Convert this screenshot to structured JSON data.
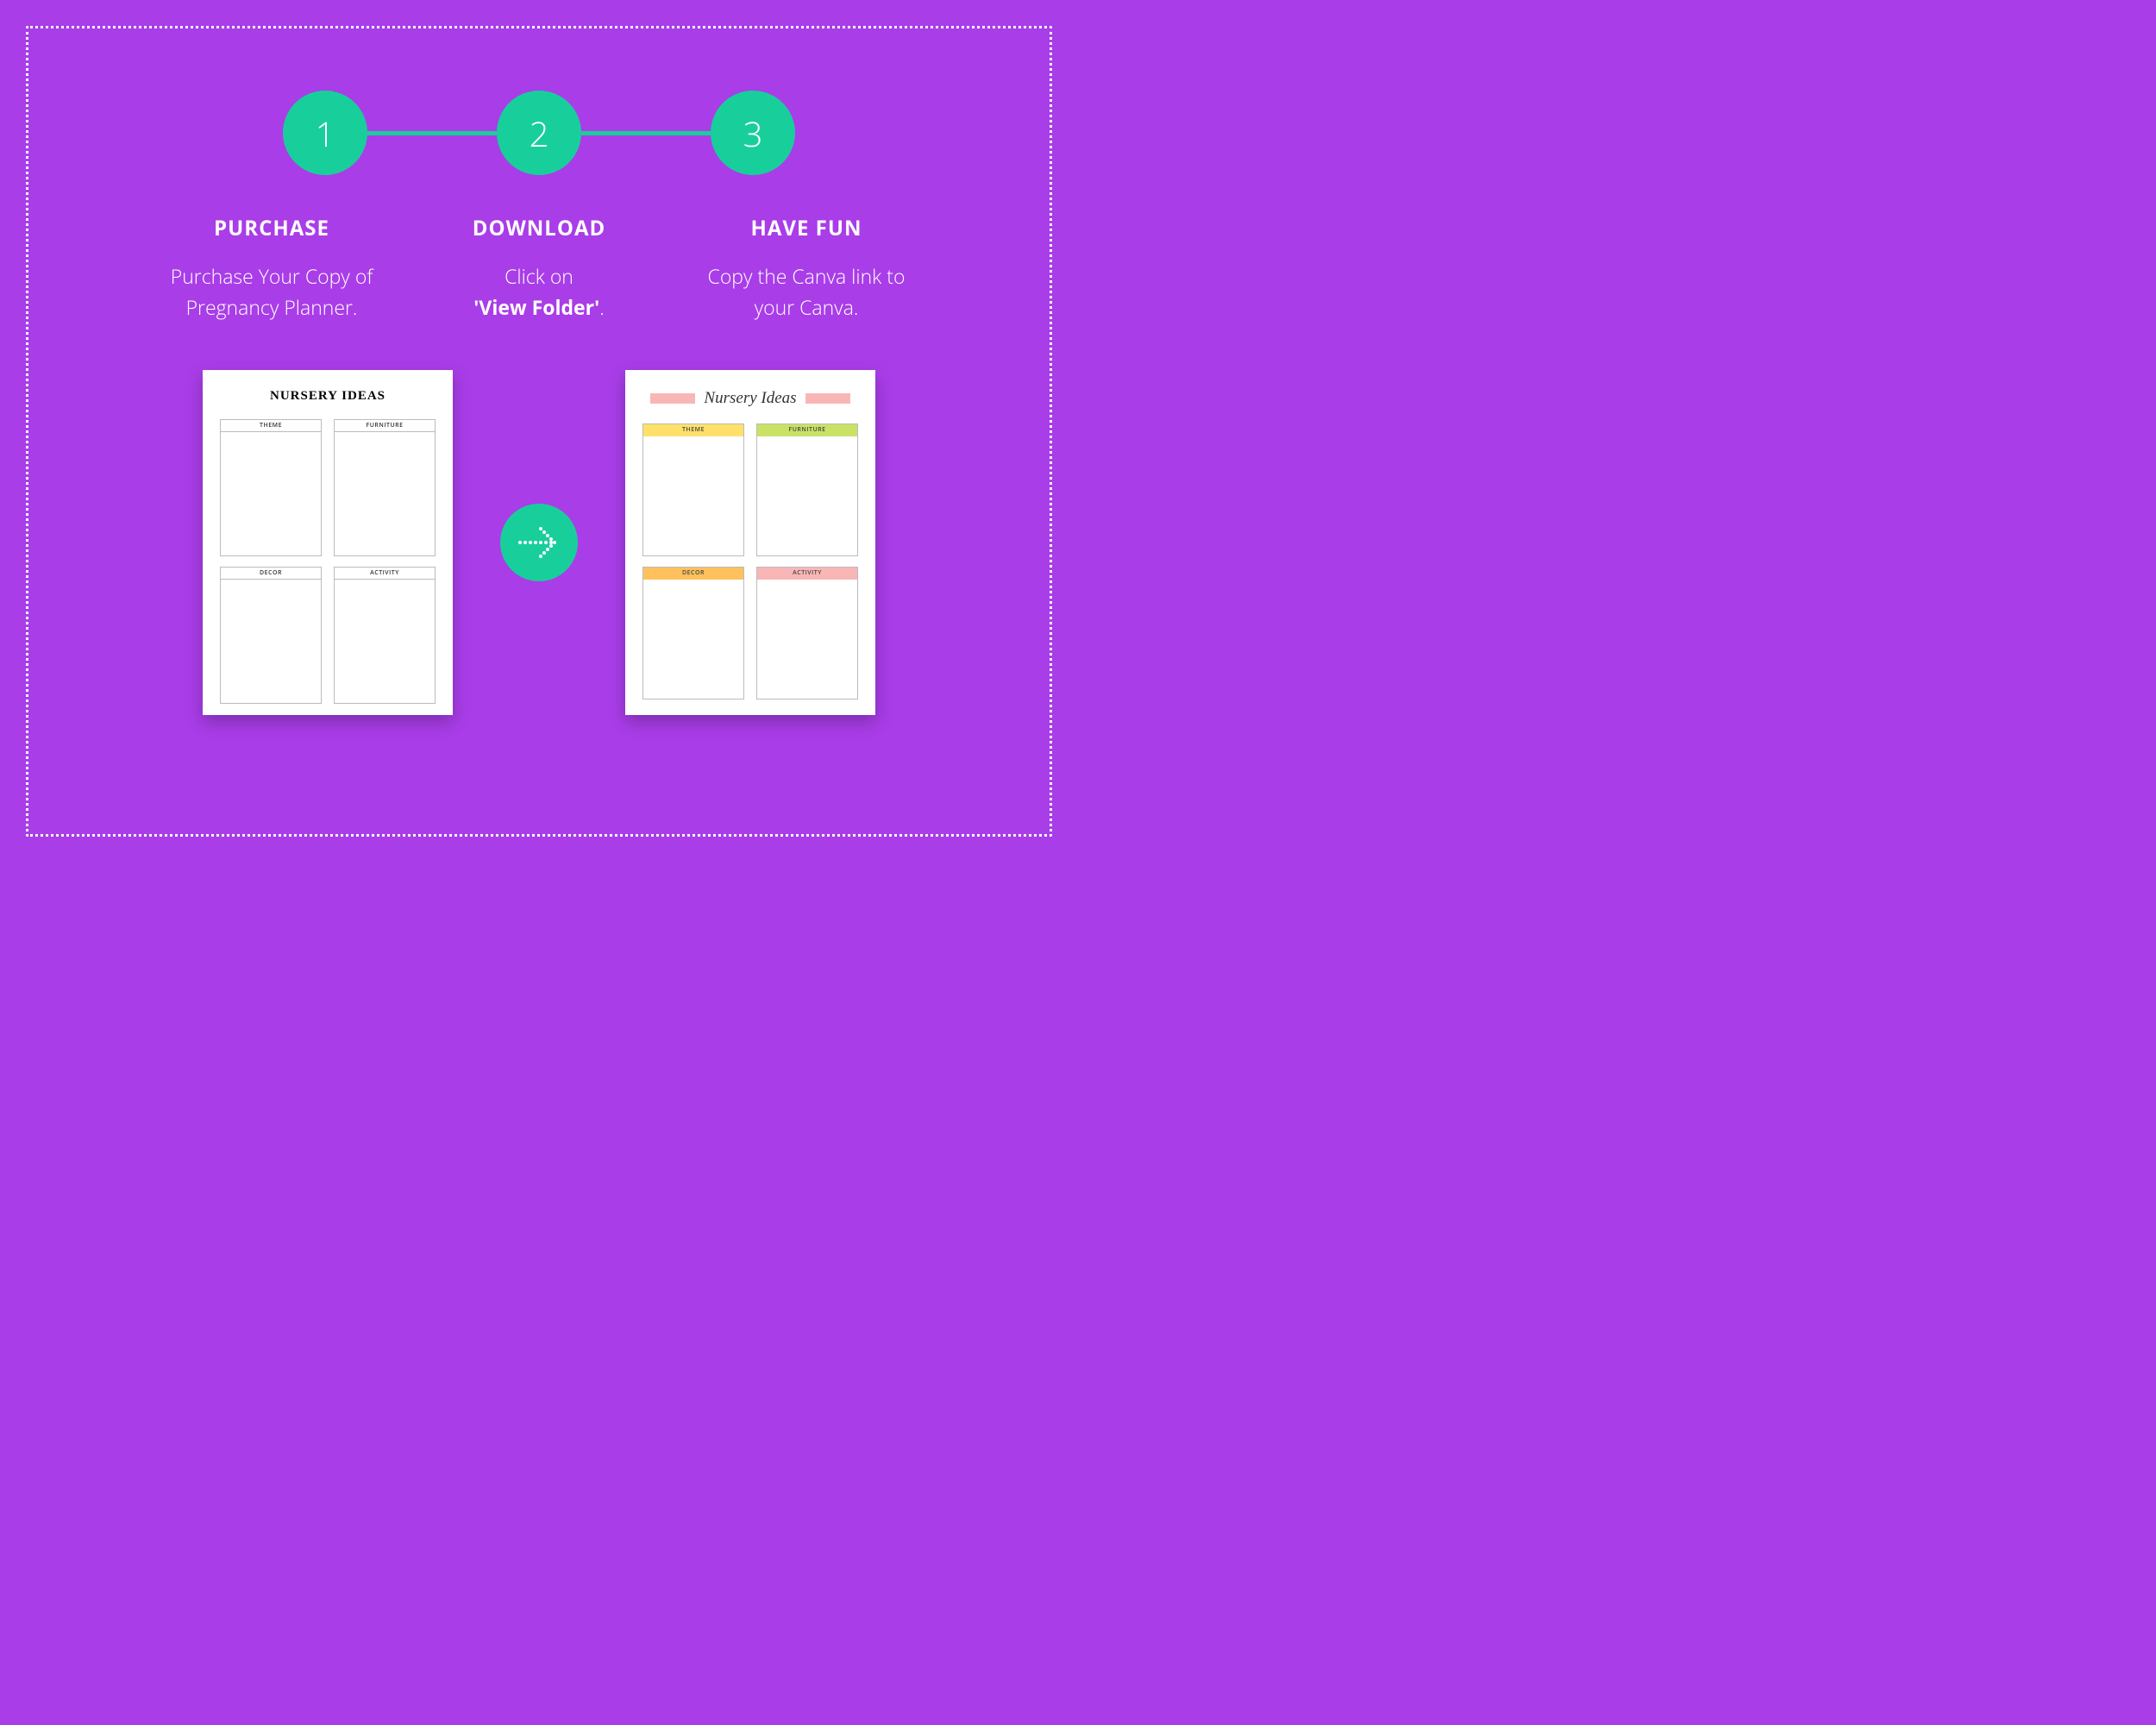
{
  "steps": [
    {
      "num": "1",
      "title": "PURCHASE",
      "desc": "Purchase Your Copy of Pregnancy Planner."
    },
    {
      "num": "2",
      "title": "DOWNLOAD",
      "desc_pre": "Click  on",
      "desc_bold": "'View Folder'",
      "desc_post": "."
    },
    {
      "num": "3",
      "title": "HAVE FUN",
      "desc": "Copy the Canva link to your Canva."
    }
  ],
  "pages": {
    "plain": {
      "title": "NURSERY IDEAS",
      "cells": [
        "THEME",
        "FURNITURE",
        "DECOR",
        "ACTIVITY"
      ]
    },
    "color": {
      "title": "Nursery Ideas",
      "cells": [
        "THEME",
        "FURNITURE",
        "DECOR",
        "ACTIVITY"
      ]
    }
  }
}
